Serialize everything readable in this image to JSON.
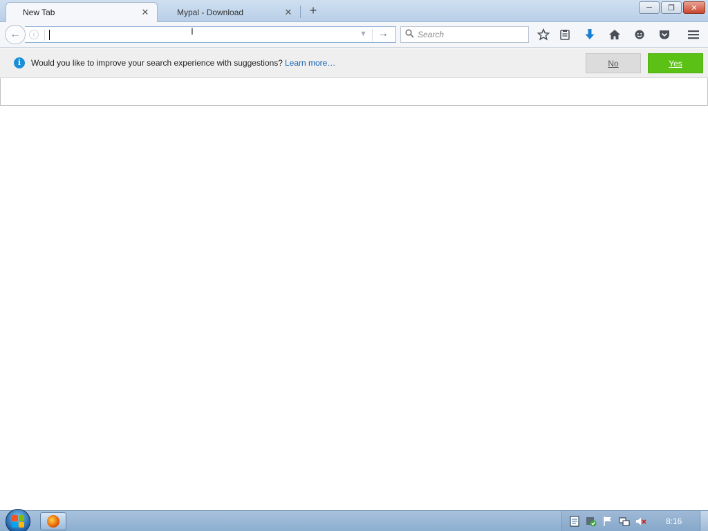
{
  "tabs": [
    {
      "label": "New Tab",
      "active": true
    },
    {
      "label": "Mypal - Download",
      "active": false
    }
  ],
  "tab_close_glyph": "✕",
  "new_tab_glyph": "+",
  "window_controls": {
    "minimize": "─",
    "restore": "❐",
    "close": "✕"
  },
  "navbar": {
    "url_value": "",
    "search_placeholder": "Search",
    "back_glyph": "←",
    "go_glyph": "→"
  },
  "toolbar_icons": [
    "bookmark-star-icon",
    "reading-list-icon",
    "download-icon",
    "home-icon",
    "social-icon",
    "pocket-icon",
    "menu-icon"
  ],
  "infobar": {
    "message": "Would you like to improve your search experience with suggestions?",
    "link": "Learn more…",
    "no_label": "No",
    "yes_label": "Yes"
  },
  "taskbar": {
    "clock": "8:16",
    "pinned": [
      "firefox-app-icon"
    ]
  },
  "colors": {
    "yes_button": "#5cc115",
    "info_icon": "#1a8fd9",
    "link": "#1464b4",
    "download_icon": "#1a7fd4"
  }
}
